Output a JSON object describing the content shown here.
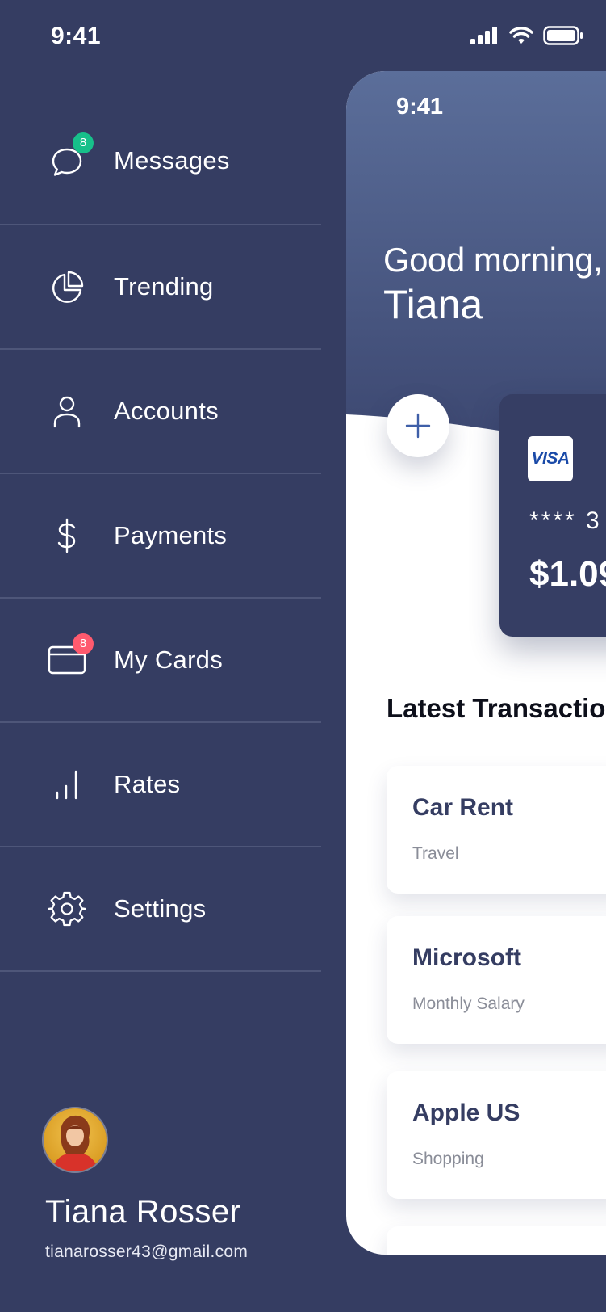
{
  "status_bar": {
    "time": "9:41"
  },
  "menu": {
    "items": [
      {
        "label": "Messages",
        "icon": "chat-bubble-icon",
        "badge": "8",
        "badge_color": "#17c08a"
      },
      {
        "label": "Trending",
        "icon": "pie-chart-icon"
      },
      {
        "label": "Accounts",
        "icon": "user-icon"
      },
      {
        "label": "Payments",
        "icon": "dollar-icon"
      },
      {
        "label": "My Cards",
        "icon": "credit-card-icon",
        "badge": "8",
        "badge_color": "#ff5a6e"
      },
      {
        "label": "Rates",
        "icon": "bar-chart-icon"
      },
      {
        "label": "Settings",
        "icon": "gear-icon"
      }
    ]
  },
  "profile": {
    "name": "Tiana Rosser",
    "email": "tianarosser43@gmail.com"
  },
  "home": {
    "time": "9:41",
    "greeting": "Good morning,",
    "user_name": "Tiana",
    "card": {
      "brand": "VISA",
      "number": "**** 3",
      "balance": "$1.09"
    },
    "transactions_title": "Latest Transactio",
    "transactions": [
      {
        "title": "Car Rent",
        "category": "Travel"
      },
      {
        "title": "Microsoft",
        "category": "Monthly Salary"
      },
      {
        "title": "Apple US",
        "category": "Shopping"
      }
    ]
  },
  "colors": {
    "background": "#353d62",
    "accent_green": "#17c08a",
    "accent_red": "#ff5a6e",
    "panel_header": "#5b6e9a"
  }
}
